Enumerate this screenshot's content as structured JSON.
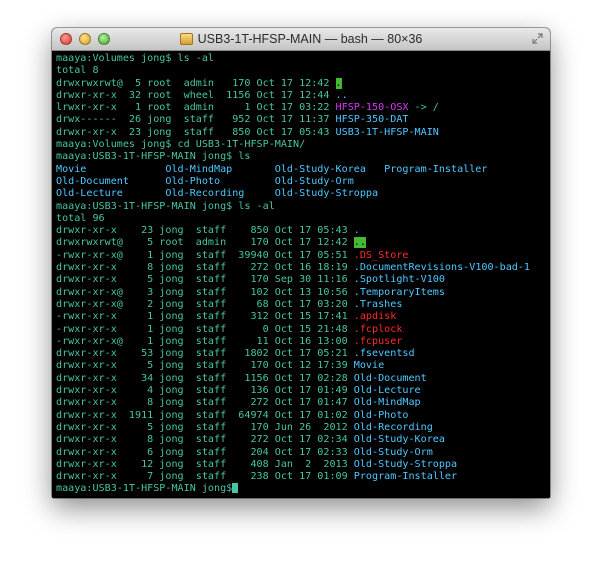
{
  "window": {
    "title": "USB3-1T-HFSP-MAIN — bash — 80×36",
    "icons": {
      "close": "close-button",
      "minimize": "minimize-button",
      "zoom": "zoom-button",
      "drive": "external-drive-icon",
      "fullscreen": "fullscreen-icon"
    }
  },
  "colors": {
    "terminal_bg": "#000000",
    "text": "#49c5a3",
    "directory": "#4ec9ff",
    "executable": "#ff2b2b",
    "symlink": "#d83cf2",
    "highlight": "#45b934"
  },
  "lines": [
    {
      "text": "maaya:Volumes jong$ ls -al"
    },
    {
      "text": "total 8"
    },
    {
      "text": "drwxrwxrwt@  5 root  admin   170 Oct 17 12:42 ",
      "name": ".",
      "kind": "hl"
    },
    {
      "text": "drwxr-xr-x  32 root  wheel  1156 Oct 17 12:44 ",
      "name": "..",
      "kind": "dir"
    },
    {
      "text": "lrwxr-xr-x   1 root  admin     1 Oct 17 03:22 ",
      "name": "HFSP-150-OSX",
      "kind": "link",
      "suffix": " -> /"
    },
    {
      "text": "drwx------  26 jong  staff   952 Oct 17 11:37 ",
      "name": "HFSP-350-DAT",
      "kind": "dir"
    },
    {
      "text": "drwxr-xr-x  23 jong  staff   850 Oct 17 05:43 ",
      "name": "USB3-1T-HFSP-MAIN",
      "kind": "dir"
    },
    {
      "text": "maaya:Volumes jong$ cd USB3-1T-HFSP-MAIN/"
    },
    {
      "text": "maaya:USB3-1T-HFSP-MAIN jong$ ls"
    },
    {
      "text": "",
      "name": "Movie             Old-MindMap       Old-Study-Korea   Program-Installer",
      "kind": "dir"
    },
    {
      "text": "",
      "name": "Old-Document      Old-Photo         Old-Study-Orm",
      "kind": "dir"
    },
    {
      "text": "",
      "name": "Old-Lecture       Old-Recording     Old-Study-Stroppa",
      "kind": "dir"
    },
    {
      "text": "maaya:USB3-1T-HFSP-MAIN jong$ ls -al"
    },
    {
      "text": "total 96"
    },
    {
      "text": "drwxr-xr-x    23 jong  staff    850 Oct 17 05:43 ",
      "name": ".",
      "kind": "dir"
    },
    {
      "text": "drwxrwxrwt@    5 root  admin    170 Oct 17 12:42 ",
      "name": "..",
      "kind": "hl"
    },
    {
      "text": "-rwxr-xr-x@    1 jong  staff  39940 Oct 17 05:51 ",
      "name": ".DS_Store",
      "kind": "exec"
    },
    {
      "text": "drwxr-xr-x     8 jong  staff    272 Oct 16 18:19 ",
      "name": ".DocumentRevisions-V100-bad-1",
      "kind": "dir"
    },
    {
      "text": "drwxr-xr-x     5 jong  staff    170 Sep 30 11:16 ",
      "name": ".Spotlight-V100",
      "kind": "dir"
    },
    {
      "text": "drwxr-xr-x@    3 jong  staff    102 Oct 13 10:56 ",
      "name": ".TemporaryItems",
      "kind": "dir"
    },
    {
      "text": "drwxr-xr-x@    2 jong  staff     68 Oct 17 03:20 ",
      "name": ".Trashes",
      "kind": "dir"
    },
    {
      "text": "-rwxr-xr-x     1 jong  staff    312 Oct 15 17:41 ",
      "name": ".apdisk",
      "kind": "exec"
    },
    {
      "text": "-rwxr-xr-x     1 jong  staff      0 Oct 15 21:48 ",
      "name": ".fcplock",
      "kind": "exec"
    },
    {
      "text": "-rwxr-xr-x@    1 jong  staff     11 Oct 16 13:00 ",
      "name": ".fcpuser",
      "kind": "exec"
    },
    {
      "text": "drwxr-xr-x    53 jong  staff   1802 Oct 17 05:21 ",
      "name": ".fseventsd",
      "kind": "dir"
    },
    {
      "text": "drwxr-xr-x     5 jong  staff    170 Oct 12 17:39 ",
      "name": "Movie",
      "kind": "dir"
    },
    {
      "text": "drwxr-xr-x    34 jong  staff   1156 Oct 17 02:28 ",
      "name": "Old-Document",
      "kind": "dir"
    },
    {
      "text": "drwxr-xr-x     4 jong  staff    136 Oct 17 01:49 ",
      "name": "Old-Lecture",
      "kind": "dir"
    },
    {
      "text": "drwxr-xr-x     8 jong  staff    272 Oct 17 01:47 ",
      "name": "Old-MindMap",
      "kind": "dir"
    },
    {
      "text": "drwxr-xr-x  1911 jong  staff  64974 Oct 17 01:02 ",
      "name": "Old-Photo",
      "kind": "dir"
    },
    {
      "text": "drwxr-xr-x     5 jong  staff    170 Jun 26  2012 ",
      "name": "Old-Recording",
      "kind": "dir"
    },
    {
      "text": "drwxr-xr-x     8 jong  staff    272 Oct 17 02:34 ",
      "name": "Old-Study-Korea",
      "kind": "dir"
    },
    {
      "text": "drwxr-xr-x     6 jong  staff    204 Oct 17 02:33 ",
      "name": "Old-Study-Orm",
      "kind": "dir"
    },
    {
      "text": "drwxr-xr-x    12 jong  staff    408 Jan  2  2013 ",
      "name": "Old-Study-Stroppa",
      "kind": "dir"
    },
    {
      "text": "drwxr-xr-x     7 jong  staff    238 Oct 17 01:09 ",
      "name": "Program-Installer",
      "kind": "dir"
    },
    {
      "text": "maaya:USB3-1T-HFSP-MAIN jong$",
      "cursor": true
    }
  ]
}
